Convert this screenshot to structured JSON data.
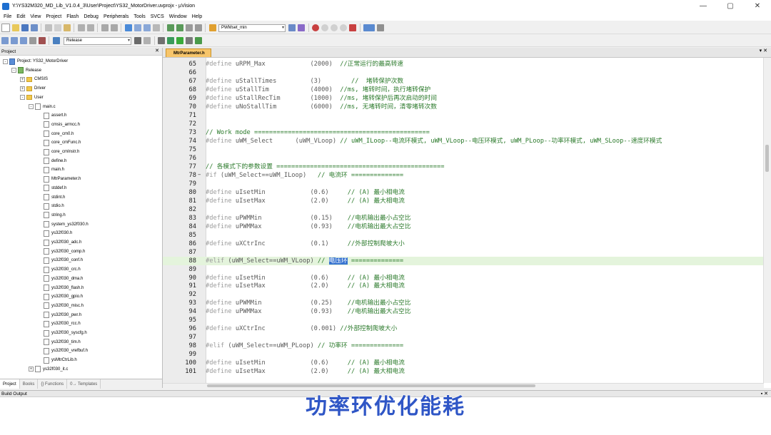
{
  "window": {
    "title": "Y:\\YS32M320_MD_Lib_V1.0.4_3\\User\\Project\\YS32_MotorDriver.uvprojx - µVision"
  },
  "menu": [
    "File",
    "Edit",
    "View",
    "Project",
    "Flash",
    "Debug",
    "Peripherals",
    "Tools",
    "SVCS",
    "Window",
    "Help"
  ],
  "toolbar": {
    "find_combo": "PWMset_min",
    "target_combo": "Release"
  },
  "project_panel": {
    "title": "Project",
    "tree": [
      {
        "level": 0,
        "type": "proj",
        "expand": "-",
        "label": "Project: YS32_MotorDriver"
      },
      {
        "level": 1,
        "type": "tgt",
        "expand": "-",
        "label": "Release"
      },
      {
        "level": 2,
        "type": "folder",
        "expand": "+",
        "label": "CMSIS"
      },
      {
        "level": 2,
        "type": "folder",
        "expand": "+",
        "label": "Driver"
      },
      {
        "level": 2,
        "type": "folder",
        "expand": "-",
        "label": "User"
      },
      {
        "level": 3,
        "type": "file",
        "expand": "-",
        "label": "main.c"
      },
      {
        "level": 4,
        "type": "file",
        "expand": "",
        "label": "assert.h"
      },
      {
        "level": 4,
        "type": "file",
        "expand": "",
        "label": "cmsis_armcc.h"
      },
      {
        "level": 4,
        "type": "file",
        "expand": "",
        "label": "core_cm0.h"
      },
      {
        "level": 4,
        "type": "file",
        "expand": "",
        "label": "core_cmFunc.h"
      },
      {
        "level": 4,
        "type": "file",
        "expand": "",
        "label": "core_cmInstr.h"
      },
      {
        "level": 4,
        "type": "file",
        "expand": "",
        "label": "define.h"
      },
      {
        "level": 4,
        "type": "file",
        "expand": "",
        "label": "main.h"
      },
      {
        "level": 4,
        "type": "file",
        "expand": "",
        "label": "MtrParameter.h"
      },
      {
        "level": 4,
        "type": "file",
        "expand": "",
        "label": "stddef.h"
      },
      {
        "level": 4,
        "type": "file",
        "expand": "",
        "label": "stdint.h"
      },
      {
        "level": 4,
        "type": "file",
        "expand": "",
        "label": "stdio.h"
      },
      {
        "level": 4,
        "type": "file",
        "expand": "",
        "label": "string.h"
      },
      {
        "level": 4,
        "type": "file",
        "expand": "",
        "label": "system_ys32f030.h"
      },
      {
        "level": 4,
        "type": "file",
        "expand": "",
        "label": "ys32f030.h"
      },
      {
        "level": 4,
        "type": "file",
        "expand": "",
        "label": "ys32f030_adc.h"
      },
      {
        "level": 4,
        "type": "file",
        "expand": "",
        "label": "ys32f030_comp.h"
      },
      {
        "level": 4,
        "type": "file",
        "expand": "",
        "label": "ys32f030_conf.h"
      },
      {
        "level": 4,
        "type": "file",
        "expand": "",
        "label": "ys32f030_crc.h"
      },
      {
        "level": 4,
        "type": "file",
        "expand": "",
        "label": "ys32f030_dma.h"
      },
      {
        "level": 4,
        "type": "file",
        "expand": "",
        "label": "ys32f030_flash.h"
      },
      {
        "level": 4,
        "type": "file",
        "expand": "",
        "label": "ys32f030_gpio.h"
      },
      {
        "level": 4,
        "type": "file",
        "expand": "",
        "label": "ys32f030_misc.h"
      },
      {
        "level": 4,
        "type": "file",
        "expand": "",
        "label": "ys32f030_pwr.h"
      },
      {
        "level": 4,
        "type": "file",
        "expand": "",
        "label": "ys32f030_rcc.h"
      },
      {
        "level": 4,
        "type": "file",
        "expand": "",
        "label": "ys32f030_syscfg.h"
      },
      {
        "level": 4,
        "type": "file",
        "expand": "",
        "label": "ys32f030_tim.h"
      },
      {
        "level": 4,
        "type": "file",
        "expand": "",
        "label": "ys32f030_vrefbuf.h"
      },
      {
        "level": 4,
        "type": "file",
        "expand": "",
        "label": "ysMtrCtrLib.h"
      },
      {
        "level": 3,
        "type": "file",
        "expand": "+",
        "label": "ys32f030_it.c"
      }
    ],
    "tabs": [
      "Project",
      "Books",
      "{} Functions",
      "0→ Templates"
    ]
  },
  "editor": {
    "tab": "MtrParameter.h",
    "lines": [
      {
        "n": "65",
        "fold": "",
        "hl": false,
        "parts": [
          [
            "kw",
            "#define "
          ],
          [
            "idf",
            "uRPM_Max            "
          ],
          [
            "num",
            "(2000)  "
          ],
          [
            "cmt",
            "//正常运行的最高转速"
          ]
        ]
      },
      {
        "n": "66",
        "fold": "",
        "hl": false,
        "parts": []
      },
      {
        "n": "67",
        "fold": "",
        "hl": false,
        "parts": [
          [
            "kw",
            "#define "
          ],
          [
            "idf",
            "uStallTimes         "
          ],
          [
            "num",
            "(3)        "
          ],
          [
            "cmt",
            "//  堵转保护次数"
          ]
        ]
      },
      {
        "n": "68",
        "fold": "",
        "hl": false,
        "parts": [
          [
            "kw",
            "#define "
          ],
          [
            "idf",
            "uStallTim           "
          ],
          [
            "num",
            "(4000)  "
          ],
          [
            "cmt",
            "//ms, 堵转时间，执行堵转保护"
          ]
        ]
      },
      {
        "n": "69",
        "fold": "",
        "hl": false,
        "parts": [
          [
            "kw",
            "#define "
          ],
          [
            "idf",
            "uStallRecTim        "
          ],
          [
            "num",
            "(1000)  "
          ],
          [
            "cmt",
            "//ms, 堵转保护后再次启动的时间"
          ]
        ]
      },
      {
        "n": "70",
        "fold": "",
        "hl": false,
        "parts": [
          [
            "kw",
            "#define "
          ],
          [
            "idf",
            "uNoStallTim         "
          ],
          [
            "num",
            "(6000)  "
          ],
          [
            "cmt",
            "//ms, 无堵转时间，清零堵转次数"
          ]
        ]
      },
      {
        "n": "71",
        "fold": "",
        "hl": false,
        "parts": []
      },
      {
        "n": "72",
        "fold": "",
        "hl": false,
        "parts": []
      },
      {
        "n": "73",
        "fold": "",
        "hl": false,
        "parts": [
          [
            "cmt",
            "// Work mode ==============================================="
          ]
        ]
      },
      {
        "n": "74",
        "fold": "",
        "hl": false,
        "parts": [
          [
            "kw",
            "#define "
          ],
          [
            "idf",
            "uWM_Select      "
          ],
          [
            "num",
            "(uWM_VLoop) "
          ],
          [
            "cmt",
            "// uWM_ILoop--电流环模式, uWM_VLoop--电压环模式, uWM_PLoop--功率环模式, uWM_SLoop--速度环模式"
          ]
        ]
      },
      {
        "n": "75",
        "fold": "",
        "hl": false,
        "parts": []
      },
      {
        "n": "76",
        "fold": "",
        "hl": false,
        "parts": []
      },
      {
        "n": "77",
        "fold": "",
        "hl": false,
        "parts": [
          [
            "cmt",
            "// 各模式下的参数设置 ============================================="
          ]
        ]
      },
      {
        "n": "78",
        "fold": "−",
        "hl": false,
        "parts": [
          [
            "kw",
            "#if "
          ],
          [
            "idf",
            "(uWM_Select==uWM_ILoop)   "
          ],
          [
            "cmt",
            "// 电流环 =============="
          ]
        ]
      },
      {
        "n": "79",
        "fold": "",
        "hl": false,
        "parts": []
      },
      {
        "n": "80",
        "fold": "",
        "hl": false,
        "parts": [
          [
            "kw",
            "#define "
          ],
          [
            "idf",
            "uIsetMin            "
          ],
          [
            "num",
            "(0.6)     "
          ],
          [
            "cmt",
            "// (A) 最小相电流"
          ]
        ]
      },
      {
        "n": "81",
        "fold": "",
        "hl": false,
        "parts": [
          [
            "kw",
            "#define "
          ],
          [
            "idf",
            "uIsetMax            "
          ],
          [
            "num",
            "(2.0)     "
          ],
          [
            "cmt",
            "// (A) 最大相电流"
          ]
        ]
      },
      {
        "n": "82",
        "fold": "",
        "hl": false,
        "parts": []
      },
      {
        "n": "83",
        "fold": "",
        "hl": false,
        "parts": [
          [
            "kw",
            "#define "
          ],
          [
            "idf",
            "uPWMMin             "
          ],
          [
            "num",
            "(0.15)    "
          ],
          [
            "cmt",
            "//电机输出最小占空比"
          ]
        ]
      },
      {
        "n": "84",
        "fold": "",
        "hl": false,
        "parts": [
          [
            "kw",
            "#define "
          ],
          [
            "idf",
            "uPWMMax             "
          ],
          [
            "num",
            "(0.93)    "
          ],
          [
            "cmt",
            "//电机输出最大占空比"
          ]
        ]
      },
      {
        "n": "85",
        "fold": "",
        "hl": false,
        "parts": []
      },
      {
        "n": "86",
        "fold": "",
        "hl": false,
        "parts": [
          [
            "kw",
            "#define "
          ],
          [
            "idf",
            "uXCtrInc            "
          ],
          [
            "num",
            "(0.1)     "
          ],
          [
            "cmt",
            "//外部控制爬坡大小"
          ]
        ]
      },
      {
        "n": "87",
        "fold": "",
        "hl": false,
        "parts": []
      },
      {
        "n": "88",
        "fold": "",
        "hl": true,
        "parts": [
          [
            "kw",
            "#elif "
          ],
          [
            "idf",
            "(uWM_Select==uWM_VLoop) "
          ],
          [
            "cmt",
            "// "
          ],
          [
            "sel",
            "电压环"
          ],
          [
            "cmt",
            " =============="
          ]
        ]
      },
      {
        "n": "89",
        "fold": "",
        "hl": false,
        "parts": []
      },
      {
        "n": "90",
        "fold": "",
        "hl": false,
        "parts": [
          [
            "kw",
            "#define "
          ],
          [
            "idf",
            "uIsetMin            "
          ],
          [
            "num",
            "(0.6)     "
          ],
          [
            "cmt",
            "// (A) 最小相电流"
          ]
        ]
      },
      {
        "n": "91",
        "fold": "",
        "hl": false,
        "parts": [
          [
            "kw",
            "#define "
          ],
          [
            "idf",
            "uIsetMax            "
          ],
          [
            "num",
            "(2.0)     "
          ],
          [
            "cmt",
            "// (A) 最大相电流"
          ]
        ]
      },
      {
        "n": "92",
        "fold": "",
        "hl": false,
        "parts": []
      },
      {
        "n": "93",
        "fold": "",
        "hl": false,
        "parts": [
          [
            "kw",
            "#define "
          ],
          [
            "idf",
            "uPWMMin             "
          ],
          [
            "num",
            "(0.25)    "
          ],
          [
            "cmt",
            "//电机输出最小占空比"
          ]
        ]
      },
      {
        "n": "94",
        "fold": "",
        "hl": false,
        "parts": [
          [
            "kw",
            "#define "
          ],
          [
            "idf",
            "uPWMMax             "
          ],
          [
            "num",
            "(0.93)    "
          ],
          [
            "cmt",
            "//电机输出最大占空比"
          ]
        ]
      },
      {
        "n": "95",
        "fold": "",
        "hl": false,
        "parts": []
      },
      {
        "n": "96",
        "fold": "",
        "hl": false,
        "parts": [
          [
            "kw",
            "#define "
          ],
          [
            "idf",
            "uXCtrInc            "
          ],
          [
            "num",
            "(0.001) "
          ],
          [
            "cmt",
            "//外部控制爬坡大小"
          ]
        ]
      },
      {
        "n": "97",
        "fold": "",
        "hl": false,
        "parts": []
      },
      {
        "n": "98",
        "fold": "",
        "hl": false,
        "parts": [
          [
            "kw",
            "#elif "
          ],
          [
            "idf",
            "(uWM_Select==uWM_PLoop) "
          ],
          [
            "cmt",
            "// 功率环 =============="
          ]
        ]
      },
      {
        "n": "99",
        "fold": "",
        "hl": false,
        "parts": []
      },
      {
        "n": "100",
        "fold": "",
        "hl": false,
        "parts": [
          [
            "kw",
            "#define "
          ],
          [
            "idf",
            "uIsetMin            "
          ],
          [
            "num",
            "(0.6)     "
          ],
          [
            "cmt",
            "// (A) 最小相电流"
          ]
        ]
      },
      {
        "n": "101",
        "fold": "",
        "hl": false,
        "parts": [
          [
            "kw",
            "#define "
          ],
          [
            "idf",
            "uIsetMax            "
          ],
          [
            "num",
            "(2.0)     "
          ],
          [
            "cmt",
            "// (A) 最大相电流"
          ]
        ]
      }
    ]
  },
  "build_output": {
    "title": "Build Output"
  },
  "caption": "功率环优化能耗"
}
